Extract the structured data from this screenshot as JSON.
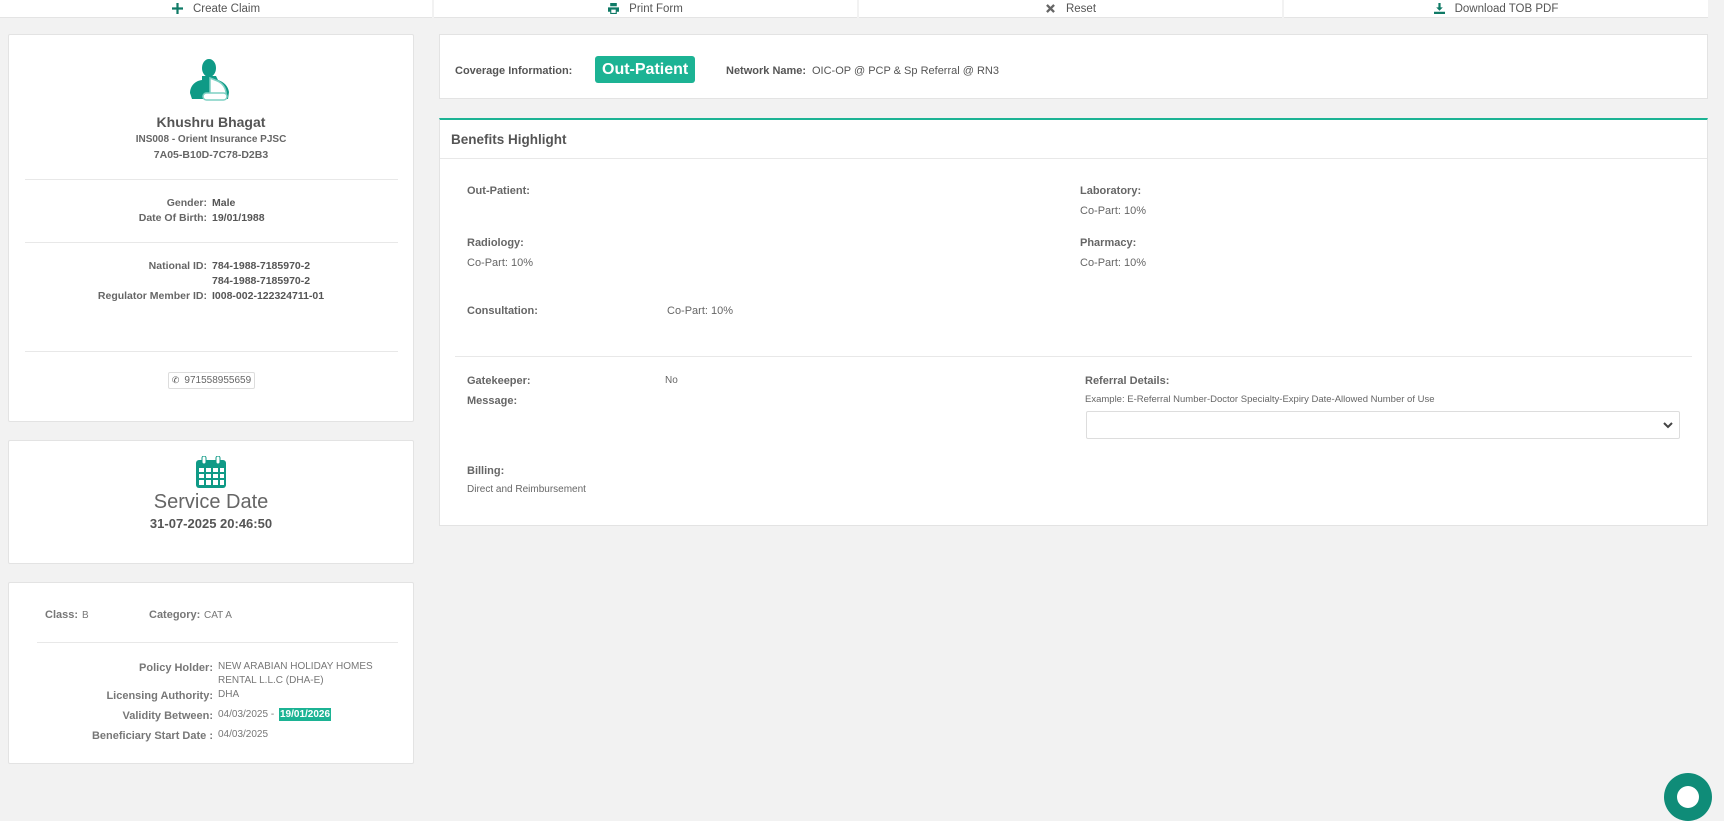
{
  "toolbar": {
    "create_claim": "Create Claim",
    "print_form": "Print Form",
    "reset": "Reset",
    "download_tob": "Download TOB PDF"
  },
  "member": {
    "name": "Khushru Bhagat",
    "insurer": "INS008 - Orient Insurance PJSC",
    "card_id": "7A05-B10D-7C78-D2B3",
    "gender_label": "Gender:",
    "gender": "Male",
    "dob_label": "Date Of Birth:",
    "dob": "19/01/1988",
    "national_id_label": "National ID:",
    "national_id": "784-1988-7185970-2",
    "national_id_2": "784-1988-7185970-2",
    "regulator_label": "Regulator Member ID:",
    "regulator_id": "I008-002-122324711-01",
    "phone": "971558955659"
  },
  "service": {
    "title": "Service Date",
    "datetime": "31-07-2025 20:46:50"
  },
  "policy": {
    "class_label": "Class:",
    "class": "B",
    "category_label": "Category:",
    "category": "CAT A",
    "holder_label": "Policy Holder:",
    "holder_line1": "NEW ARABIAN HOLIDAY HOMES",
    "holder_line2": "RENTAL L.L.C (DHA-E)",
    "authority_label": "Licensing Authority:",
    "authority": "DHA",
    "validity_label": "Validity Between:",
    "validity_start": "04/03/2025 -",
    "validity_end": "19/01/2026",
    "start_label": "Beneficiary Start Date :",
    "start_date": "04/03/2025"
  },
  "coverage": {
    "label": "Coverage Information:",
    "badge": "Out-Patient",
    "network_label": "Network Name:",
    "network": "OIC-OP @ PCP & Sp Referral @ RN3"
  },
  "benefits": {
    "title": "Benefits Highlight",
    "outpatient": "Out-Patient:",
    "laboratory": "Laboratory:",
    "laboratory_val": "Co-Part: 10%",
    "radiology": "Radiology:",
    "radiology_val": "Co-Part: 10%",
    "pharmacy": "Pharmacy:",
    "pharmacy_val": "Co-Part: 10%",
    "consultation": "Consultation:",
    "consultation_val": "Co-Part: 10%",
    "gatekeeper": "Gatekeeper:",
    "gatekeeper_val": "No",
    "message": "Message:",
    "referral": "Referral Details:",
    "referral_example": "Example: E-Referral Number-Doctor Specialty-Expiry Date-Allowed Number of Use",
    "billing": "Billing:",
    "billing_val": "Direct and Reimbursement"
  },
  "colors": {
    "accent": "#1cb394",
    "icon": "#0f9a86"
  }
}
